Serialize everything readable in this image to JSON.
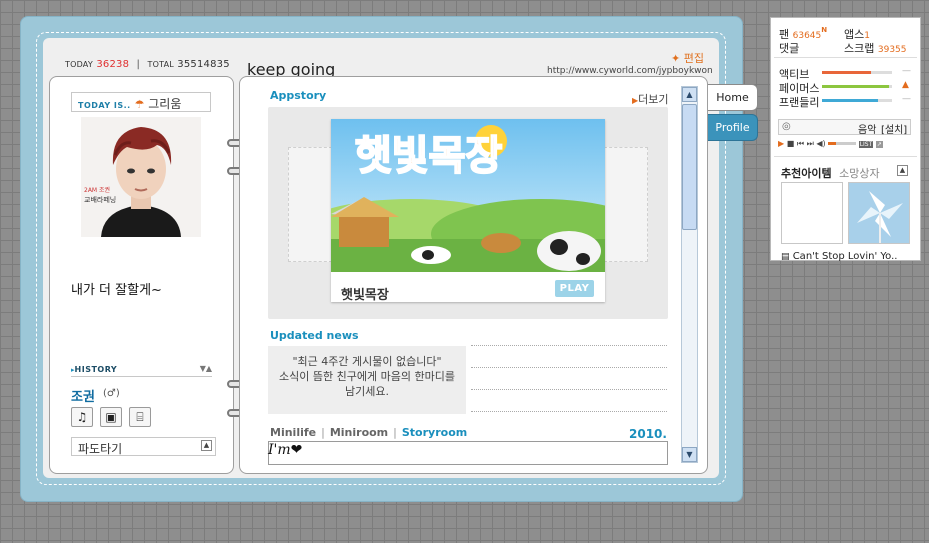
{
  "header": {
    "today_label": "TODAY",
    "today_count": "36238",
    "total_label": "TOTAL",
    "total_count": "35514835",
    "edit_label": "✦ 편집",
    "site_title": "keep going",
    "site_url": "http://www.cyworld.com/jypboykwon"
  },
  "left": {
    "today_is_label": "TODAY IS..",
    "mood_icon": "umbrella-icon",
    "mood": "그리움",
    "intro": "내가 더 잘할게~",
    "history_label": "HISTORY",
    "owner_name": "조권",
    "owner_gender": "(♂)",
    "icons": [
      "music-icon",
      "radio-icon",
      "tv-icon"
    ],
    "surf_label": "파도타기"
  },
  "main": {
    "appstory_title": "Appstory",
    "more_label": "더보기",
    "app_name": "햇빛목장",
    "app_art_title": "햇빛목장",
    "play_label": "PLAY",
    "news_title": "Updated news",
    "news_line1": "\"최근 4주간 게시물이 없습니다\"",
    "news_line2": "소식이 뜸한 친구에게 마음의 한마디를",
    "news_line3": "남기세요.",
    "tabs": [
      "Minilife",
      "Miniroom",
      "Storyroom"
    ],
    "active_tab": "Storyroom",
    "year": "2010.",
    "story_text": "I'm"
  },
  "nav": {
    "home": "Home",
    "profile": "Profile"
  },
  "widget": {
    "fans_label": "팬",
    "fans_count": "63645",
    "fans_new": "N",
    "apps_label": "앱스",
    "apps_count": "1",
    "comments_label": "댓글",
    "scrap_label": "스크랩",
    "scrap_count": "39355",
    "stats": [
      {
        "label": "액티브",
        "level": 0.7,
        "color": "#e8663a"
      },
      {
        "label": "페이머스",
        "level": 0.95,
        "color": "#8cc63f"
      },
      {
        "label": "프랜들리",
        "level": 0.8,
        "color": "#3fa9d6"
      }
    ],
    "music_label": "음악",
    "music_setting": "[설치]",
    "list_label": "LIST",
    "rec_tab1": "추천아이템",
    "rec_tab2": "소망상자",
    "rec_caption": "Can't Stop Lovin' Yo.."
  }
}
